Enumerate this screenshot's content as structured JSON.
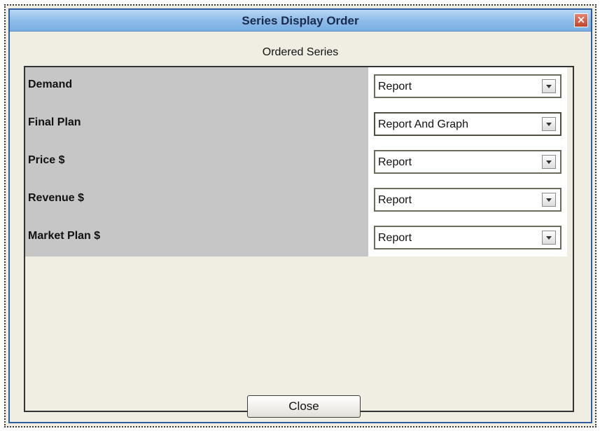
{
  "window": {
    "title": "Series Display Order",
    "close_glyph": "×"
  },
  "panel": {
    "heading": "Ordered Series"
  },
  "series": [
    {
      "label": "Demand",
      "value": "Report"
    },
    {
      "label": "Final Plan",
      "value": "Report And Graph"
    },
    {
      "label": "Price $",
      "value": "Report"
    },
    {
      "label": "Revenue $",
      "value": "Report"
    },
    {
      "label": "Market Plan $",
      "value": "Report"
    }
  ],
  "footer": {
    "close_label": "Close"
  },
  "colors": {
    "title_bar": "#8bbbe9",
    "label_bg": "#c6c6c6",
    "dialog_bg": "#f0eee2",
    "close_icon": "#c0432b"
  }
}
